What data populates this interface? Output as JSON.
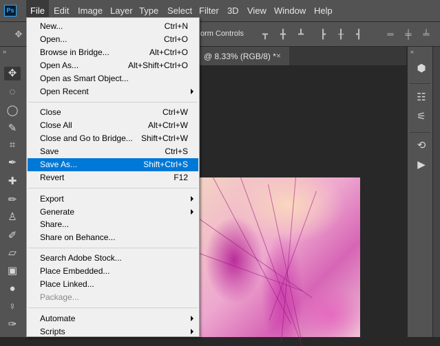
{
  "app": {
    "logo_text": "Ps"
  },
  "menubar": {
    "items": [
      "File",
      "Edit",
      "Image",
      "Layer",
      "Type",
      "Select",
      "Filter",
      "3D",
      "View",
      "Window",
      "Help"
    ],
    "active": "File"
  },
  "options_bar": {
    "transform_label": "orm Controls"
  },
  "document": {
    "tab_title": "@ 8.33% (RGB/8) *",
    "close_glyph": "×"
  },
  "file_menu": {
    "items": [
      {
        "label": "New...",
        "shortcut": "Ctrl+N"
      },
      {
        "label": "Open...",
        "shortcut": "Ctrl+O"
      },
      {
        "label": "Browse in Bridge...",
        "shortcut": "Alt+Ctrl+O"
      },
      {
        "label": "Open As...",
        "shortcut": "Alt+Shift+Ctrl+O"
      },
      {
        "label": "Open as Smart Object...",
        "shortcut": ""
      },
      {
        "label": "Open Recent",
        "shortcut": "",
        "submenu": true
      },
      {
        "label": "Close",
        "shortcut": "Ctrl+W"
      },
      {
        "label": "Close All",
        "shortcut": "Alt+Ctrl+W"
      },
      {
        "label": "Close and Go to Bridge...",
        "shortcut": "Shift+Ctrl+W"
      },
      {
        "label": "Save",
        "shortcut": "Ctrl+S"
      },
      {
        "label": "Save As...",
        "shortcut": "Shift+Ctrl+S",
        "highlighted": true
      },
      {
        "label": "Revert",
        "shortcut": "F12"
      },
      {
        "label": "Export",
        "shortcut": "",
        "submenu": true
      },
      {
        "label": "Generate",
        "shortcut": "",
        "submenu": true
      },
      {
        "label": "Share...",
        "shortcut": ""
      },
      {
        "label": "Share on Behance...",
        "shortcut": ""
      },
      {
        "label": "Search Adobe Stock...",
        "shortcut": ""
      },
      {
        "label": "Place Embedded...",
        "shortcut": ""
      },
      {
        "label": "Place Linked...",
        "shortcut": ""
      },
      {
        "label": "Package...",
        "shortcut": "",
        "disabled": true
      },
      {
        "label": "Automate",
        "shortcut": "",
        "submenu": true
      },
      {
        "label": "Scripts",
        "shortcut": "",
        "submenu": true
      }
    ]
  },
  "tools": [
    "move-tool",
    "marquee-tool",
    "lasso-tool",
    "quick-selection-tool",
    "crop-tool",
    "eyedropper-tool",
    "healing-brush-tool",
    "brush-tool",
    "clone-stamp-tool",
    "history-brush-tool",
    "eraser-tool",
    "gradient-tool",
    "blur-tool",
    "dodge-tool",
    "pen-tool"
  ],
  "right_panel_icons": [
    "3d-icon",
    "brush-settings-icon",
    "adjust-icon",
    "history-icon",
    "play-icon"
  ],
  "colors": {
    "menu_highlight": "#0078d7",
    "app_bg": "#535353",
    "canvas_bg": "#282828"
  }
}
